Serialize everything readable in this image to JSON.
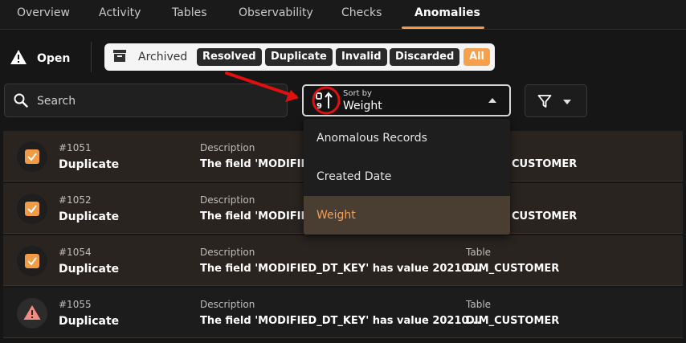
{
  "tabs": [
    {
      "label": "Overview"
    },
    {
      "label": "Activity"
    },
    {
      "label": "Tables"
    },
    {
      "label": "Observability"
    },
    {
      "label": "Checks"
    },
    {
      "label": "Anomalies",
      "active": true
    }
  ],
  "status": {
    "open_label": "Open",
    "archived_label": "Archived",
    "chips": [
      "Resolved",
      "Duplicate",
      "Invalid",
      "Discarded",
      "All"
    ],
    "active_chip": "All",
    "accent_color": "#f5a04a"
  },
  "search": {
    "placeholder": "Search",
    "icon": "search-icon"
  },
  "sort": {
    "label": "Sort by",
    "value": "Weight",
    "options": [
      "Anomalous Records",
      "Created Date",
      "Weight"
    ],
    "selected": "Weight"
  },
  "filter": {
    "icon": "filter-icon"
  },
  "table": {
    "description_label": "Description",
    "table_label": "Table",
    "rows": [
      {
        "id": "#1051",
        "type": "Duplicate",
        "description": "The field 'MODIFIED_",
        "table": "CUSTOMER",
        "status": "checked"
      },
      {
        "id": "#1052",
        "type": "Duplicate",
        "description": "The field 'MODIFIED_",
        "table": "CUSTOMER",
        "status": "checked"
      },
      {
        "id": "#1054",
        "type": "Duplicate",
        "description": "The field 'MODIFIED_DT_KEY' has value 20210...",
        "table": "DIM_CUSTOMER",
        "status": "checked"
      },
      {
        "id": "#1055",
        "type": "Duplicate",
        "description": "The field 'MODIFIED_DT_KEY' has value 20210...",
        "table": "DIM_CUSTOMER",
        "status": "warning"
      }
    ]
  }
}
